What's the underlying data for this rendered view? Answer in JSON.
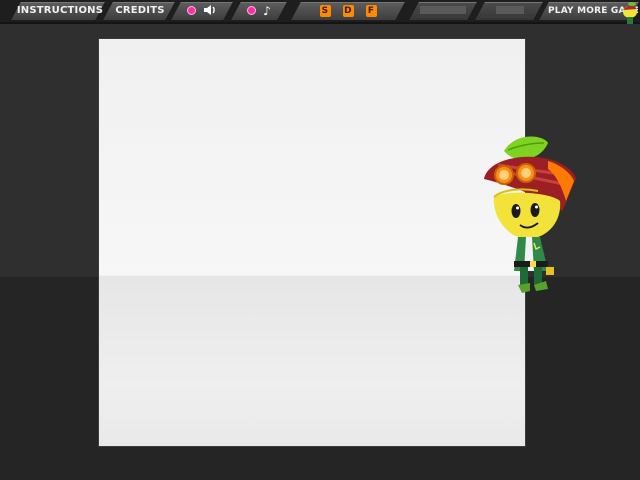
{
  "toolbar": {
    "instructions_label": "INSTRUCTIONS",
    "credits_label": "CREDITS",
    "sound_toggle_icon": "speaker-icon",
    "music_toggle_icon": "music-note-icon",
    "quality_buttons": [
      "S",
      "D",
      "F"
    ],
    "play_more_label": "PLAY MORE GAMES"
  },
  "colors": {
    "background": "#2f2f2f",
    "toggle_dot": "#ff2fa6",
    "quality_button": "#ff8a00",
    "stage": "#f2f2f2"
  },
  "character": {
    "icon": "fruit-character-with-red-hat-and-goggles"
  }
}
